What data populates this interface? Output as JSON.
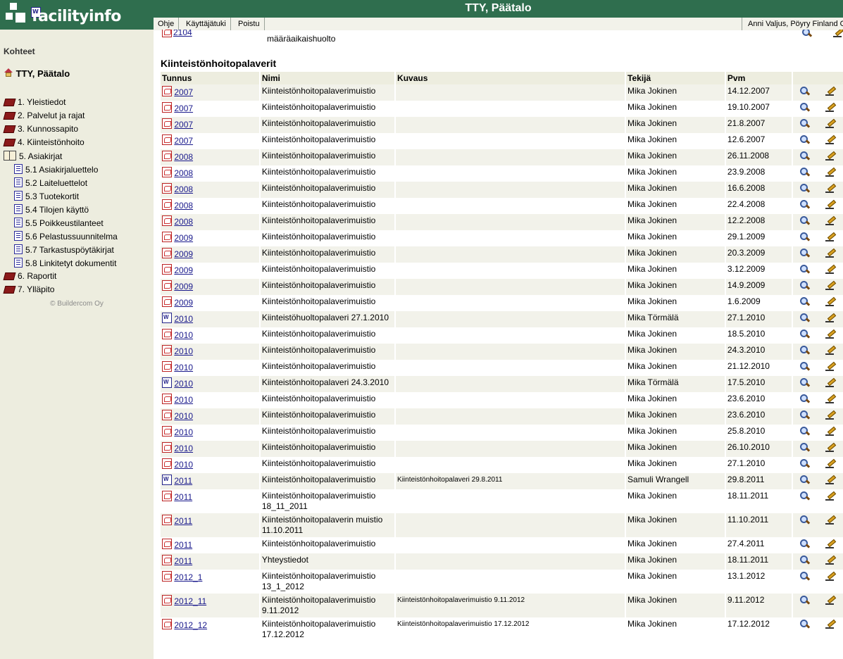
{
  "header": {
    "logo_text": "facilityinfo",
    "title": "TTY, Päätalo",
    "menu": [
      "Ohje",
      "Käyttäjätuki",
      "Poistu"
    ],
    "user": "Anni Valjus, Pöyry Finland Oy"
  },
  "sidebar": {
    "heading": "Kohteet",
    "building": "TTY, Päätalo",
    "items": [
      {
        "label": "1. Yleistiedot",
        "icon": "book-icon"
      },
      {
        "label": "2. Palvelut ja rajat",
        "icon": "book-icon"
      },
      {
        "label": "3. Kunnossapito",
        "icon": "book-icon"
      },
      {
        "label": "4. Kiinteistönhoito",
        "icon": "book-icon"
      },
      {
        "label": "5. Asiakirjat",
        "icon": "open-book-icon"
      },
      {
        "label": "5.1 Asiakirjaluettelo",
        "icon": "document-icon",
        "sub": true
      },
      {
        "label": "5.2 Laiteluettelot",
        "icon": "document-icon",
        "sub": true
      },
      {
        "label": "5.3 Tuotekortit",
        "icon": "document-icon",
        "sub": true
      },
      {
        "label": "5.4 Tilojen käyttö",
        "icon": "document-icon",
        "sub": true
      },
      {
        "label": "5.5 Poikkeustilanteet",
        "icon": "document-icon",
        "sub": true
      },
      {
        "label": "5.6 Pelastussuunnitelma",
        "icon": "document-icon",
        "sub": true
      },
      {
        "label": "5.7 Tarkastuspöytäkirjat",
        "icon": "document-icon",
        "sub": true
      },
      {
        "label": "5.8 Linkitetyt dokumentit",
        "icon": "document-icon",
        "sub": true
      },
      {
        "label": "6. Raportit",
        "icon": "book-icon"
      },
      {
        "label": "7. Ylläpito",
        "icon": "book-icon"
      }
    ],
    "copyright": "© Buildercom Oy"
  },
  "previous_row": {
    "id": "2104",
    "name": "määräaikaishuolto"
  },
  "section": {
    "title": "Kiinteistönhoitopalaverit",
    "columns": [
      "Tunnus",
      "Nimi",
      "Kuvaus",
      "Tekijä",
      "Pvm",
      ""
    ],
    "rows": [
      {
        "type": "pdf",
        "id": "2007",
        "name": "Kiinteistönhoitopalaverimuistio",
        "desc": "",
        "author": "Mika Jokinen",
        "date": "14.12.2007"
      },
      {
        "type": "pdf",
        "id": "2007",
        "name": "Kiinteistönhoitopalaverimuistio",
        "desc": "",
        "author": "Mika Jokinen",
        "date": "19.10.2007"
      },
      {
        "type": "pdf",
        "id": "2007",
        "name": "Kiinteistönhoitopalaverimuistio",
        "desc": "",
        "author": "Mika Jokinen",
        "date": "21.8.2007"
      },
      {
        "type": "pdf",
        "id": "2007",
        "name": "Kiinteistönhoitopalaverimuistio",
        "desc": "",
        "author": "Mika Jokinen",
        "date": "12.6.2007"
      },
      {
        "type": "pdf",
        "id": "2008",
        "name": "Kiinteistönhoitopalaverimuistio",
        "desc": "",
        "author": "Mika Jokinen",
        "date": "26.11.2008"
      },
      {
        "type": "pdf",
        "id": "2008",
        "name": "Kiinteistönhoitopalaverimuistio",
        "desc": "",
        "author": "Mika Jokinen",
        "date": "23.9.2008"
      },
      {
        "type": "pdf",
        "id": "2008",
        "name": "Kiinteistönhoitopalaverimuistio",
        "desc": "",
        "author": "Mika Jokinen",
        "date": "16.6.2008"
      },
      {
        "type": "pdf",
        "id": "2008",
        "name": "Kiinteistönhoitopalaverimuistio",
        "desc": "",
        "author": "Mika Jokinen",
        "date": "22.4.2008"
      },
      {
        "type": "pdf",
        "id": "2008",
        "name": "Kiinteistönhoitopalaverimuistio",
        "desc": "",
        "author": "Mika Jokinen",
        "date": "12.2.2008"
      },
      {
        "type": "pdf",
        "id": "2009",
        "name": "Kiinteistönhoitopalaverimuistio",
        "desc": "",
        "author": "Mika Jokinen",
        "date": "29.1.2009"
      },
      {
        "type": "pdf",
        "id": "2009",
        "name": "Kiinteistönhoitopalaverimuistio",
        "desc": "",
        "author": "Mika Jokinen",
        "date": "20.3.2009"
      },
      {
        "type": "pdf",
        "id": "2009",
        "name": "Kiinteistönhoitopalaverimuistio",
        "desc": "",
        "author": "Mika Jokinen",
        "date": "3.12.2009"
      },
      {
        "type": "pdf",
        "id": "2009",
        "name": "Kiinteistönhoitopalaverimuistio",
        "desc": "",
        "author": "Mika Jokinen",
        "date": "14.9.2009"
      },
      {
        "type": "pdf",
        "id": "2009",
        "name": "Kiinteistönhoitopalaverimuistio",
        "desc": "",
        "author": "Mika Jokinen",
        "date": "1.6.2009"
      },
      {
        "type": "word",
        "id": "2010",
        "name": "Kiinteistöhuoltopalaveri 27.1.2010",
        "desc": "",
        "author": "Mika Törmälä",
        "date": "27.1.2010"
      },
      {
        "type": "pdf",
        "id": "2010",
        "name": "Kiinteistönhoitopalaverimuistio",
        "desc": "",
        "author": "Mika Jokinen",
        "date": "18.5.2010"
      },
      {
        "type": "pdf",
        "id": "2010",
        "name": "Kiinteistönhoitopalaverimuistio",
        "desc": "",
        "author": "Mika Jokinen",
        "date": "24.3.2010"
      },
      {
        "type": "pdf",
        "id": "2010",
        "name": "Kiinteistönhoitopalaverimuistio",
        "desc": "",
        "author": "Mika Jokinen",
        "date": "21.12.2010"
      },
      {
        "type": "word",
        "id": "2010",
        "name": "Kiinteistönhoitopalaveri 24.3.2010",
        "desc": "",
        "author": "Mika Törmälä",
        "date": "17.5.2010"
      },
      {
        "type": "pdf",
        "id": "2010",
        "name": "Kiinteistönhoitopalaverimuistio",
        "desc": "",
        "author": "Mika Jokinen",
        "date": "23.6.2010"
      },
      {
        "type": "pdf",
        "id": "2010",
        "name": "Kiinteistönhoitopalaverimuistio",
        "desc": "",
        "author": "Mika Jokinen",
        "date": "23.6.2010"
      },
      {
        "type": "pdf",
        "id": "2010",
        "name": "Kiinteistönhoitopalaverimuistio",
        "desc": "",
        "author": "Mika Jokinen",
        "date": "25.8.2010"
      },
      {
        "type": "pdf",
        "id": "2010",
        "name": "Kiinteistönhoitopalaverimuistio",
        "desc": "",
        "author": "Mika Jokinen",
        "date": "26.10.2010"
      },
      {
        "type": "pdf",
        "id": "2010",
        "name": "Kiinteistönhoitopalaverimuistio",
        "desc": "",
        "author": "Mika Jokinen",
        "date": "27.1.2010"
      },
      {
        "type": "word",
        "id": "2011",
        "name": "Kiinteistönhoitopalaverimuistio",
        "desc": "Kiinteistönhoitopalaveri 29.8.2011",
        "author": "Samuli Wrangell",
        "date": "29.8.2011"
      },
      {
        "type": "pdf",
        "id": "2011",
        "name": "Kiinteistönhoitopalaverimuistio 18_11_2011",
        "desc": "",
        "author": "Mika Jokinen",
        "date": "18.11.2011"
      },
      {
        "type": "pdf",
        "id": "2011",
        "name": "Kiinteistönhoitopalaverin muistio 11.10.2011",
        "desc": "",
        "author": "Mika Jokinen",
        "date": "11.10.2011"
      },
      {
        "type": "pdf",
        "id": "2011",
        "name": "Kiinteistönhoitopalaverimuistio",
        "desc": "",
        "author": "Mika Jokinen",
        "date": "27.4.2011"
      },
      {
        "type": "pdf",
        "id": "2011",
        "name": "Yhteystiedot",
        "desc": "",
        "author": "Mika Jokinen",
        "date": "18.11.2011"
      },
      {
        "type": "pdf",
        "id": "2012_1",
        "name": "Kiinteistönhoitopalaverimuistio 13_1_2012",
        "desc": "",
        "author": "Mika Jokinen",
        "date": "13.1.2012"
      },
      {
        "type": "pdf",
        "id": "2012_11",
        "name": "Kiinteistönhoitopalaverimuistio 9.11.2012",
        "desc": "Kiinteistönhoitopalaverimuistio 9.11.2012",
        "author": "Mika Jokinen",
        "date": "9.11.2012"
      },
      {
        "type": "pdf",
        "id": "2012_12",
        "name": "Kiinteistönhoitopalaverimuistio 17.12.2012",
        "desc": "Kiinteistönhoitopalaverimuistio 17.12.2012",
        "author": "Mika Jokinen",
        "date": "17.12.2012"
      }
    ]
  }
}
